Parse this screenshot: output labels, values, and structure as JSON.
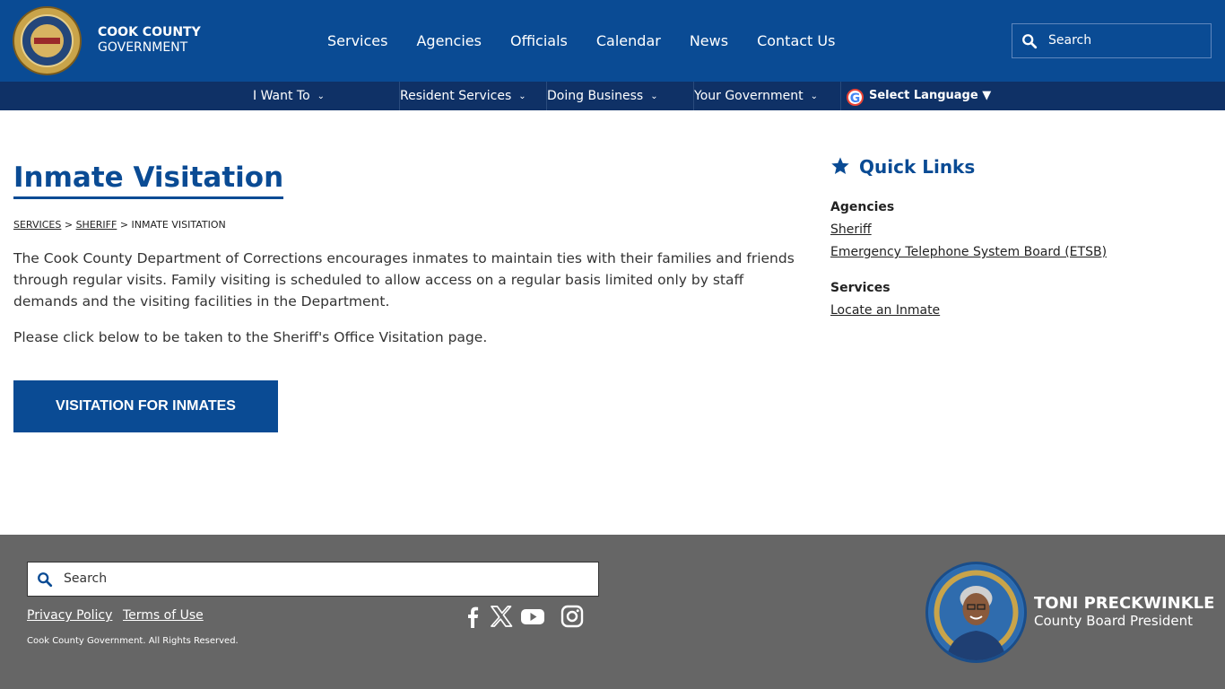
{
  "header": {
    "brand_line1": "COOK COUNTY",
    "brand_line2": "GOVERNMENT",
    "seal_text": "SEAL OF COOK COUNTY ILLINOIS",
    "nav": [
      "Services",
      "Agencies",
      "Officials",
      "Calendar",
      "News",
      "Contact Us"
    ],
    "search_placeholder": "Search",
    "colors": {
      "primary": "#0a4b94",
      "subnav": "#0f3166"
    }
  },
  "subnav": {
    "items": [
      "I Want To",
      "Resident Services",
      "Doing Business",
      "Your Government"
    ],
    "language_label": "Select Language ▼"
  },
  "main": {
    "title": "Inmate Visitation",
    "breadcrumb": {
      "services": "SERVICES",
      "sheriff": "SHERIFF",
      "current": "INMATE VISITATION",
      "separator": ">"
    },
    "paragraph1": "The Cook County Department of Corrections encourages inmates to maintain ties with their families and friends through regular visits. Family visiting is scheduled to allow access on a regular basis limited only by staff demands and the visiting facilities in the Department.",
    "paragraph2": "Please click below to be taken to the Sheriff's Office Visitation page.",
    "cta_label": "VISITATION FOR INMATES"
  },
  "quick_links": {
    "title": "Quick Links",
    "sections": [
      {
        "heading": "Agencies",
        "links": [
          "Sheriff",
          "Emergency Telephone System Board (ETSB)"
        ]
      },
      {
        "heading": "Services",
        "links": [
          "Locate an Inmate"
        ]
      }
    ]
  },
  "footer": {
    "search_placeholder": "Search",
    "privacy": "Privacy Policy",
    "terms": "Terms of Use",
    "copyright": "Cook County Government. All Rights Reserved.",
    "social_icons": [
      "facebook-icon",
      "x-icon",
      "youtube-icon",
      "instagram-icon"
    ],
    "president_name": "TONI PRECKWINKLE",
    "president_title": "County Board President"
  }
}
